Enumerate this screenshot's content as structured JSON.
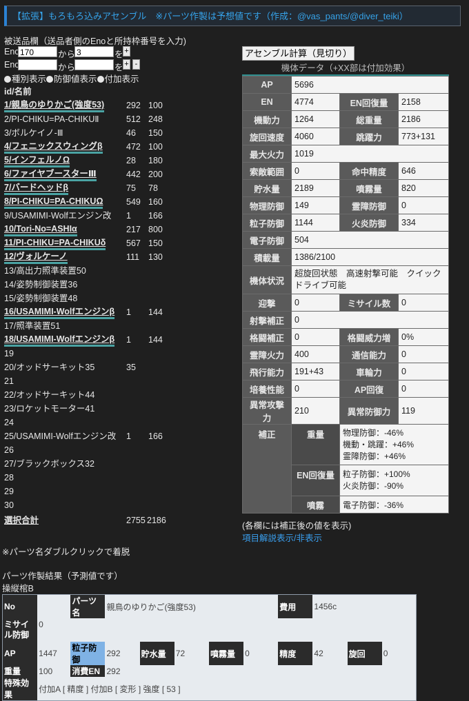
{
  "header": {
    "title": "【拡張】もろもろ込みアセンブル　※パーツ作製は予想値です（作成：@vas_pants/@diver_teiki）"
  },
  "send": {
    "label": "被送品欄（送品者側のEnoと所持枠番号を入力)",
    "row1": {
      "eno_label": "Eno",
      "eno_value": "170",
      "from_label": "から",
      "slot_value": "3",
      "wo_label": "を",
      "plus": "+"
    },
    "row2": {
      "eno_label": "Eno",
      "eno_value": "",
      "from_label": "から",
      "slot_value": "",
      "wo_label": "を",
      "plus": "+",
      "minus": "-"
    }
  },
  "display_options": [
    "種別表示",
    "防御値表示",
    "付加表示"
  ],
  "list": {
    "header": "id/名前",
    "rows": [
      {
        "name": "1/親鳥のゆりかご(強度53)",
        "c1": "292",
        "c2": "100",
        "equipped": true
      },
      {
        "name": "2/PI-CHIKU=PA-CHIKUⅡ",
        "c1": "512",
        "c2": "248",
        "equipped": false
      },
      {
        "name": "3/ボルケイノ-Ⅲ",
        "c1": "46",
        "c2": "150",
        "equipped": false
      },
      {
        "name": "4/フェニックスウィングβ",
        "c1": "472",
        "c2": "100",
        "equipped": true
      },
      {
        "name": "5/インフェルノΩ",
        "c1": "28",
        "c2": "180",
        "equipped": true
      },
      {
        "name": "6/ファイヤブースターⅢ",
        "c1": "442",
        "c2": "200",
        "equipped": true
      },
      {
        "name": "7/バードヘッドβ",
        "c1": "75",
        "c2": "78",
        "equipped": true
      },
      {
        "name": "8/PI-CHIKU=PA-CHIKUΩ",
        "c1": "549",
        "c2": "160",
        "equipped": true
      },
      {
        "name": "9/USAMIMI-Wolfエンジン改",
        "c1": "1",
        "c2": "166",
        "equipped": false
      },
      {
        "name": "10/Tori-No=ASHIα",
        "c1": "217",
        "c2": "800",
        "equipped": true
      },
      {
        "name": "11/PI-CHIKU=PA-CHIKUδ",
        "c1": "567",
        "c2": "150",
        "equipped": true
      },
      {
        "name": "12/ヴォルケーノ",
        "c1": "111",
        "c2": "130",
        "equipped": true
      },
      {
        "name": "13/高出力照準装置50",
        "c1": "",
        "c2": "",
        "equipped": false
      },
      {
        "name": "14/姿勢制御装置36",
        "c1": "",
        "c2": "",
        "equipped": false
      },
      {
        "name": "15/姿勢制御装置48",
        "c1": "",
        "c2": "",
        "equipped": false
      },
      {
        "name": "16/USAMIMI-Wolfエンジンβ",
        "c1": "1",
        "c2": "144",
        "equipped": true
      },
      {
        "name": "17/照準装置51",
        "c1": "",
        "c2": "",
        "equipped": false
      },
      {
        "name": "18/USAMIMI-Wolfエンジンβ",
        "c1": "1",
        "c2": "144",
        "equipped": true
      },
      {
        "name": "19",
        "c1": "",
        "c2": "",
        "equipped": false
      },
      {
        "name": "20/オッドサーキット35",
        "c1": "35",
        "c2": "",
        "equipped": false
      },
      {
        "name": "21",
        "c1": "",
        "c2": "",
        "equipped": false
      },
      {
        "name": "22/オッドサーキット44",
        "c1": "",
        "c2": "",
        "equipped": false
      },
      {
        "name": "23/ロケットモーター41",
        "c1": "",
        "c2": "",
        "equipped": false
      },
      {
        "name": "24",
        "c1": "",
        "c2": "",
        "equipped": false
      },
      {
        "name": "25/USAMIMI-Wolfエンジン改",
        "c1": "1",
        "c2": "166",
        "equipped": false
      },
      {
        "name": "26",
        "c1": "",
        "c2": "",
        "equipped": false
      },
      {
        "name": "27/ブラックボックス32",
        "c1": "",
        "c2": "",
        "equipped": false
      },
      {
        "name": "28",
        "c1": "",
        "c2": "",
        "equipped": false
      },
      {
        "name": "29",
        "c1": "",
        "c2": "",
        "equipped": false
      },
      {
        "name": "30",
        "c1": "",
        "c2": "",
        "equipped": false
      }
    ],
    "total": {
      "label": "選択合計",
      "c1": "2755",
      "c2": "2186"
    },
    "dblclick_note": "※パーツ名ダブルクリックで着脱"
  },
  "machine": {
    "calc_button": "アセンブル計算（見切り）",
    "title": "機体データ（+XX部は付加効果）",
    "ap": {
      "k": "AP",
      "v": "5696"
    },
    "pairs": [
      {
        "k1": "EN",
        "v1": "4774",
        "k2": "EN回復量",
        "v2": "2158"
      },
      {
        "k1": "機動力",
        "v1": "1264",
        "k2": "総重量",
        "v2": "2186"
      },
      {
        "k1": "旋回速度",
        "v1": "4060",
        "k2": "跳躍力",
        "v2": "773+131"
      }
    ],
    "max_fire": {
      "k": "最大火力",
      "v": "1019"
    },
    "pairs2": [
      {
        "k1": "索敵範囲",
        "v1": "0",
        "k2": "命中精度",
        "v2": "646"
      },
      {
        "k1": "貯水量",
        "v1": "2189",
        "k2": "噴霧量",
        "v2": "820"
      },
      {
        "k1": "物理防御",
        "v1": "149",
        "k2": "霊障防御",
        "v2": "0"
      },
      {
        "k1": "粒子防御",
        "v1": "1144",
        "k2": "火炎防御",
        "v2": "334"
      }
    ],
    "elec_def": {
      "k": "電子防御",
      "v": "504"
    },
    "load": {
      "k": "積載量",
      "v": "1386/2100"
    },
    "status": {
      "k": "機体状況",
      "v": "超旋回状態　高速射撃可能　クイックドライブ可能"
    },
    "intercept": {
      "k1": "迎撃",
      "v1": "0",
      "k2": "ミサイル数",
      "v2": "0"
    },
    "shoot": {
      "k": "射撃補正",
      "v": "0"
    },
    "pairs3": [
      {
        "k1": "格闘補正",
        "v1": "0",
        "k2": "格闘威力増",
        "v2": "0%"
      },
      {
        "k1": "霊障火力",
        "v1": "400",
        "k2": "通信能力",
        "v2": "0"
      },
      {
        "k1": "飛行能力",
        "v1": "191+43",
        "k2": "車輪力",
        "v2": "0"
      },
      {
        "k1": "培養性能",
        "v1": "0",
        "k2": "AP回復",
        "v2": "0"
      },
      {
        "k1": "異常攻撃力",
        "v1": "210",
        "k2": "異常防御力",
        "v2": "119"
      }
    ],
    "correction": {
      "k": "補正",
      "rows": [
        {
          "k": "重量",
          "lines": [
            "物理防御：-46%",
            "機動・跳躍：+46%",
            "霊障防御：+46%"
          ]
        },
        {
          "k": "EN回復量",
          "lines": [
            "粒子防御：+100%",
            "火炎防御：-90%"
          ]
        },
        {
          "k": "噴霧",
          "lines": [
            "電子防御：-36%"
          ]
        }
      ]
    },
    "note": "(各欄には補正後の値を表示)",
    "toggle_link": "項目解説表示/非表示"
  },
  "result": {
    "label": "パーツ作製結果（予測値です）",
    "sub": "操縦棺B",
    "no_k": "No",
    "no_v": "",
    "name_k": "パーツ名",
    "name_v": "親鳥のゆりかご(強度53)",
    "cost_k": "費用",
    "cost_v": "1456c",
    "missile_k": "ミサイル防御",
    "missile_v": "0",
    "ap_k": "AP",
    "ap_v": "1447",
    "pdef_k": "粒子防御",
    "pdef_v": "292",
    "water_k": "貯水量",
    "water_v": "72",
    "mist_k": "噴霧量",
    "mist_v": "0",
    "acc_k": "精度",
    "acc_v": "42",
    "turn_k": "旋回",
    "turn_v": "0",
    "weight_k": "重量",
    "weight_v": "100",
    "en_k": "消費EN",
    "en_v": "292",
    "special_k": "特殊効果",
    "special_v": "付加A [ 精度 ] 付加B [ 変形 ] 強度 [ 53 ]"
  }
}
